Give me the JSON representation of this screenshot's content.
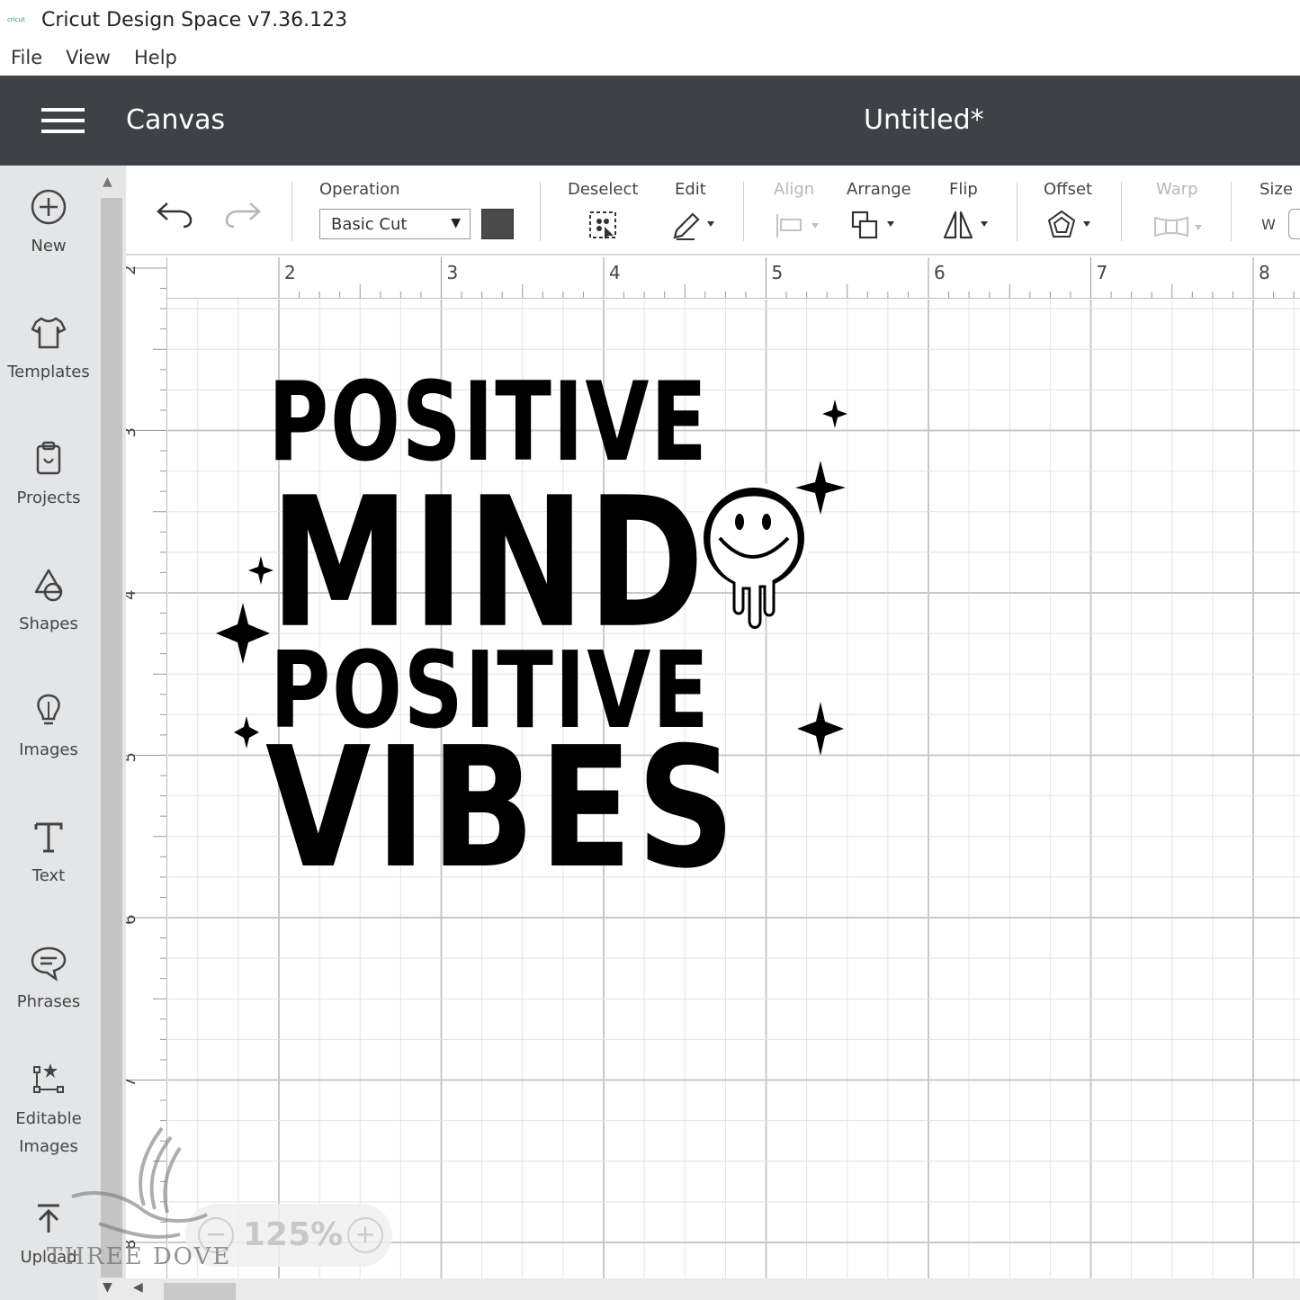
{
  "window": {
    "title": "Cricut Design Space  v7.36.123",
    "logo_text": "cricut"
  },
  "menubar": {
    "items": [
      "File",
      "View",
      "Help"
    ]
  },
  "header": {
    "section": "Canvas",
    "document": "Untitled*"
  },
  "sidebar": {
    "items": [
      {
        "label": "New",
        "icon": "plus-circle-icon"
      },
      {
        "label": "Templates",
        "icon": "tshirt-icon"
      },
      {
        "label": "Projects",
        "icon": "clipboard-icon"
      },
      {
        "label": "Shapes",
        "icon": "shapes-icon"
      },
      {
        "label": "Images",
        "icon": "lightbulb-icon"
      },
      {
        "label": "Text",
        "icon": "text-icon"
      },
      {
        "label": "Phrases",
        "icon": "speech-bubble-icon"
      },
      {
        "label": "Editable Images",
        "icon": "edit-nodes-icon"
      },
      {
        "label": "Upload",
        "icon": "upload-icon"
      }
    ]
  },
  "toolbar": {
    "operation_label": "Operation",
    "operation_value": "Basic Cut",
    "operation_color": "#4a4a4a",
    "deselect_label": "Deselect",
    "edit_label": "Edit",
    "align_label": "Align",
    "arrange_label": "Arrange",
    "flip_label": "Flip",
    "offset_label": "Offset",
    "warp_label": "Warp",
    "size_label": "Size",
    "size_w_label": "W"
  },
  "rulers": {
    "top": [
      "2",
      "3",
      "4",
      "5",
      "6",
      "7",
      "8"
    ],
    "left": [
      "2",
      "3",
      "4",
      "5",
      "6",
      "7",
      "8"
    ]
  },
  "zoom": {
    "value": "125%"
  },
  "design": {
    "lines": [
      "POSITIVE",
      "MIND",
      "POSITIVE",
      "VIBES"
    ]
  },
  "watermark": {
    "text": "THREE DOVE"
  }
}
